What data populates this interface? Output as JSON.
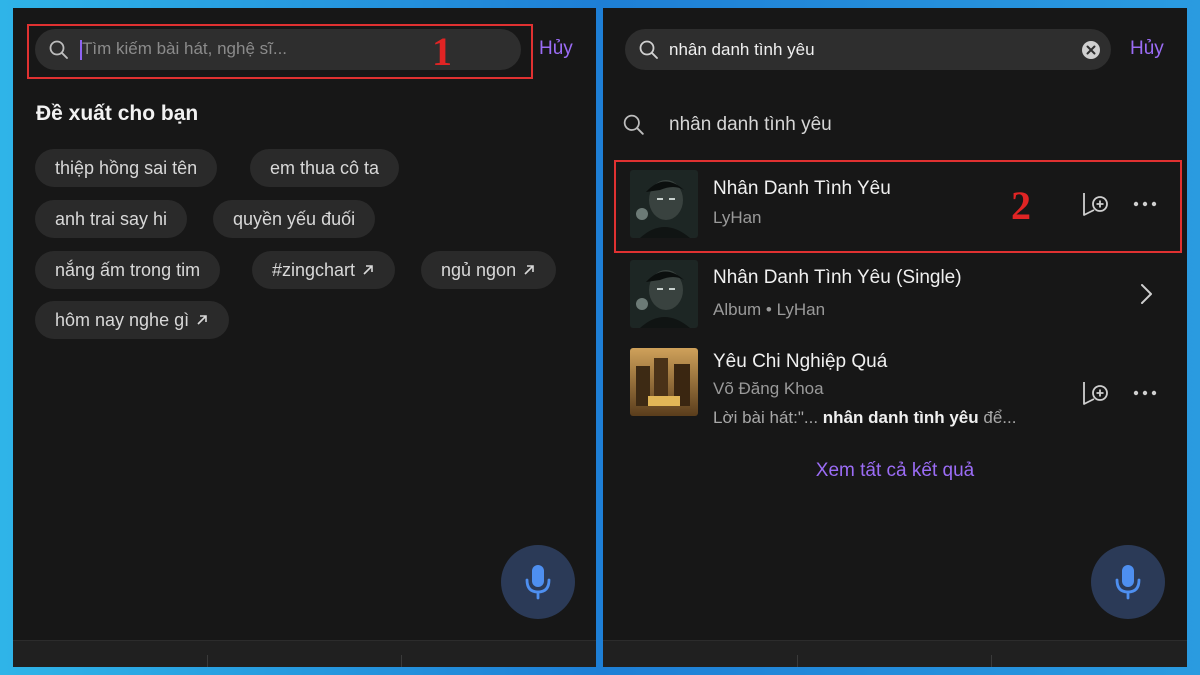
{
  "left": {
    "search": {
      "placeholder": "Tìm kiếm bài hát, nghệ sĩ..."
    },
    "cancel_label": "Hủy",
    "annotation_number": "1",
    "section_title": "Đề xuất cho bạn",
    "chips": [
      {
        "label": "thiệp hồng sai tên",
        "trending": false
      },
      {
        "label": "em thua cô ta",
        "trending": false
      },
      {
        "label": "anh trai say hi",
        "trending": false
      },
      {
        "label": "quyền yếu đuối",
        "trending": false
      },
      {
        "label": "nắng ấm trong tim",
        "trending": false
      },
      {
        "label": "#zingchart",
        "trending": true
      },
      {
        "label": "ngủ ngon",
        "trending": true
      },
      {
        "label": "hôm nay nghe gì",
        "trending": true
      }
    ]
  },
  "right": {
    "search": {
      "value": "nhân danh tình yêu"
    },
    "cancel_label": "Hủy",
    "suggestion": "nhân danh tình yêu",
    "annotation_number": "2",
    "results": [
      {
        "title": "Nhân Danh Tình Yêu",
        "subtitle": "LyHan"
      },
      {
        "title": "Nhân Danh Tình Yêu (Single)",
        "subtitle": "Album • LyHan"
      },
      {
        "title": "Yêu Chi Nghiệp Quá",
        "subtitle": "Võ Đăng Khoa",
        "lyric_prefix": "Lời bài hát:\"... ",
        "lyric_match": "nhân danh tình yêu",
        "lyric_suffix": " để..."
      }
    ],
    "see_all": "Xem tất cả kết quả"
  },
  "colors": {
    "accent": "#9b6cf5",
    "annotation": "#e02424",
    "panel_bg": "#171717"
  },
  "icons": [
    "search-icon",
    "clear-icon",
    "microphone-icon",
    "add-to-playlist-icon",
    "more-icon",
    "chevron-right-icon",
    "arrow-up-right-icon"
  ]
}
